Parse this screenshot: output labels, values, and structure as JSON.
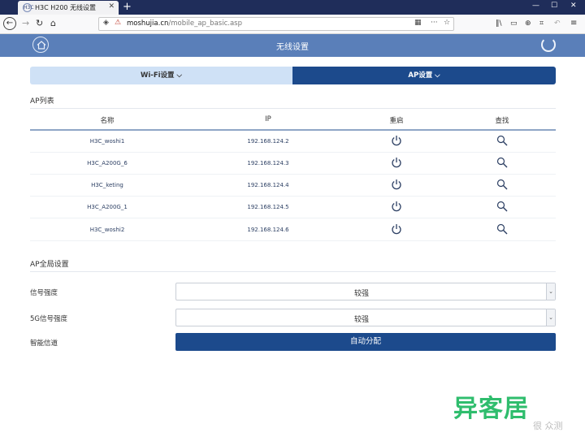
{
  "browser": {
    "tab_title": "H3C H200 无线设置",
    "tab_favicon": "H3C",
    "url_host": "moshujia.cn",
    "url_path": "/mobile_ap_basic.asp"
  },
  "header": {
    "title": "无线设置"
  },
  "subtabs": {
    "wifi": "Wi-Fi设置 ⌵",
    "ap": "AP设置 ⌵"
  },
  "ap_list": {
    "title": "AP列表",
    "columns": [
      "名称",
      "IP",
      "重启",
      "查找"
    ],
    "rows": [
      {
        "name": "H3C_woshi1",
        "ip": "192.168.124.2"
      },
      {
        "name": "H3C_A200G_6",
        "ip": "192.168.124.3"
      },
      {
        "name": "H3C_keting",
        "ip": "192.168.124.4"
      },
      {
        "name": "H3C_A200G_1",
        "ip": "192.168.124.5"
      },
      {
        "name": "H3C_woshi2",
        "ip": "192.168.124.6"
      }
    ]
  },
  "global": {
    "title": "AP全局设置",
    "signal_label": "信号强度",
    "signal_value": "较强",
    "signal5g_label": "5G信号强度",
    "signal5g_value": "较强",
    "channel_label": "智能信道",
    "channel_button": "自动分配"
  },
  "watermark": {
    "main": "异客居",
    "sub": "很 众测"
  },
  "colors": {
    "header": "#5a7fb9",
    "accent": "#1c4a8c",
    "tab_inactive": "#cfe1f6",
    "watermark": "#2fbd6d"
  }
}
